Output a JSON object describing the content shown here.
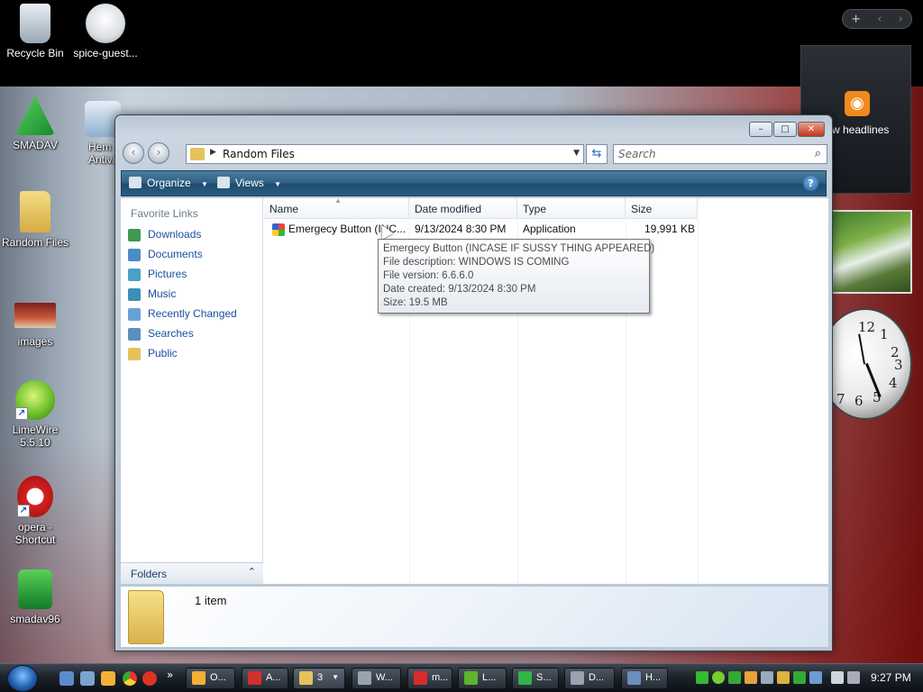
{
  "desktop": {
    "icons": [
      {
        "label": "Recycle Bin"
      },
      {
        "label": "spice-guest..."
      },
      {
        "label": "SMADAV"
      },
      {
        "label": "Hem\nAntivi"
      },
      {
        "label": "Random Files"
      },
      {
        "label": "images"
      },
      {
        "label": "LimeWire\n5.5.10"
      },
      {
        "label": "opera -\nShortcut"
      },
      {
        "label": "smadav96"
      }
    ]
  },
  "sidebar": {
    "controls": [
      "+",
      "‹",
      "›"
    ],
    "feed_label": "w headlines"
  },
  "clock_gadget": {
    "numbers": [
      "12",
      "1",
      "2",
      "3",
      "4",
      "5",
      "6",
      "7"
    ]
  },
  "window": {
    "caption_buttons": {
      "minimize": "–",
      "maximize": "□",
      "close": "✕"
    },
    "nav": {
      "back": "‹",
      "forward": "›"
    },
    "address": {
      "path": "Random Files"
    },
    "search": {
      "placeholder": "Search"
    },
    "toolbar": {
      "organize": "Organize",
      "views": "Views",
      "help": "?"
    },
    "favorite_links_header": "Favorite Links",
    "favorite_links": [
      {
        "label": "Downloads",
        "color": "#3e9a52"
      },
      {
        "label": "Documents",
        "color": "#4b8cc8"
      },
      {
        "label": "Pictures",
        "color": "#4aa0c8"
      },
      {
        "label": "Music",
        "color": "#3b8fb6"
      },
      {
        "label": "Recently Changed",
        "color": "#6aa0d8"
      },
      {
        "label": "Searches",
        "color": "#5b8fc0"
      },
      {
        "label": "Public",
        "color": "#e6c25a"
      }
    ],
    "folders_label": "Folders",
    "columns": [
      "Name",
      "Date modified",
      "Type",
      "Size"
    ],
    "files": [
      {
        "name": "Emergecy Button (INC...",
        "date": "9/13/2024 8:30 PM",
        "type": "Application",
        "size": "19,991 KB"
      }
    ],
    "tooltip": [
      "Emergecy Button (INCASE IF SUSSY THING APPEARED)",
      "File description: WINDOWS IS COMING",
      "File version: 6.6.6.0",
      "Date created: 9/13/2024 8:30 PM",
      "Size: 19.5 MB"
    ],
    "details": {
      "count": "1 item"
    }
  },
  "taskbar": {
    "more": "»",
    "tasks": [
      {
        "label": "O...",
        "color": "#f2b134"
      },
      {
        "label": "A...",
        "color": "#d32f2f"
      },
      {
        "label": "3",
        "color": "#e6c25a"
      },
      {
        "label": "W...",
        "color": "#9aa4b0"
      },
      {
        "label": "m...",
        "color": "#d92b2b"
      },
      {
        "label": "L...",
        "color": "#5cb52a"
      },
      {
        "label": "S...",
        "color": "#33b34a"
      },
      {
        "label": "D...",
        "color": "#9aa4b0"
      },
      {
        "label": "H...",
        "color": "#6a8ec0"
      }
    ],
    "time": "9:27 PM"
  }
}
